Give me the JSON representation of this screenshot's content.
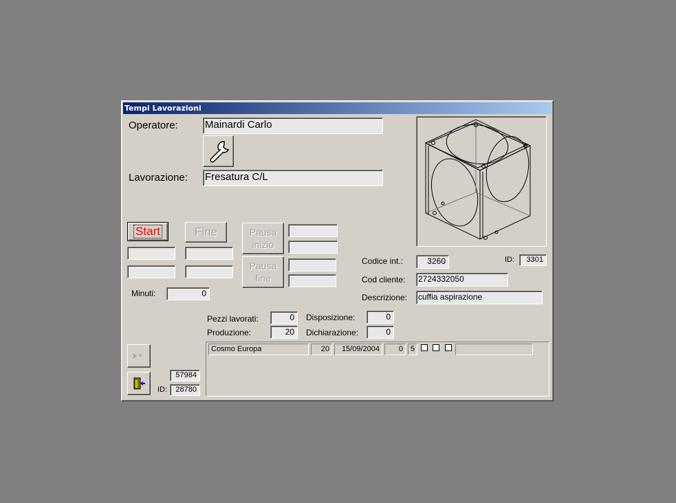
{
  "window": {
    "title": "Tempi Lavorazioni"
  },
  "operatore": {
    "label": "Operatore:",
    "value": "Mainardi Carlo"
  },
  "lavorazione": {
    "label": "Lavorazione:",
    "value": "Fresatura C/L"
  },
  "tool_button": {
    "icon": "wrench-icon"
  },
  "buttons": {
    "start": "Start",
    "fine": "Fine",
    "pausa_inizio": "Pausa inizio",
    "pausa_fine": "Pausa fine"
  },
  "minuti": {
    "label": "Minuti:",
    "value": "0"
  },
  "codice_int": {
    "label": "Codice  int.:",
    "value": "3260"
  },
  "id_top": {
    "label": "ID:",
    "value": "3301"
  },
  "cod_cliente": {
    "label": "Cod cliente:",
    "value": "2724332050"
  },
  "descrizione": {
    "label": "Descrizione:",
    "value": "cuffia aspirazione"
  },
  "pezzi_lavorati": {
    "label": "Pezzi lavorati:",
    "value": "0"
  },
  "produzione": {
    "label": "Produzione:",
    "value": "20"
  },
  "disposizione": {
    "label": "Disposizione:",
    "value": "0"
  },
  "dichiarazione": {
    "label": "Dichiarazione:",
    "value": "0"
  },
  "record": {
    "value": "57984"
  },
  "id_bottom": {
    "label": "ID:",
    "value": "28780"
  },
  "order_row": {
    "cliente": "Cosmo Europa",
    "qty": "20",
    "date": "15/09/2004",
    "n1": "0",
    "n2": "5"
  },
  "icons": {
    "new_record": "new-record-icon",
    "exit": "exit-door-icon",
    "part_image": "cube-part-drawing"
  }
}
